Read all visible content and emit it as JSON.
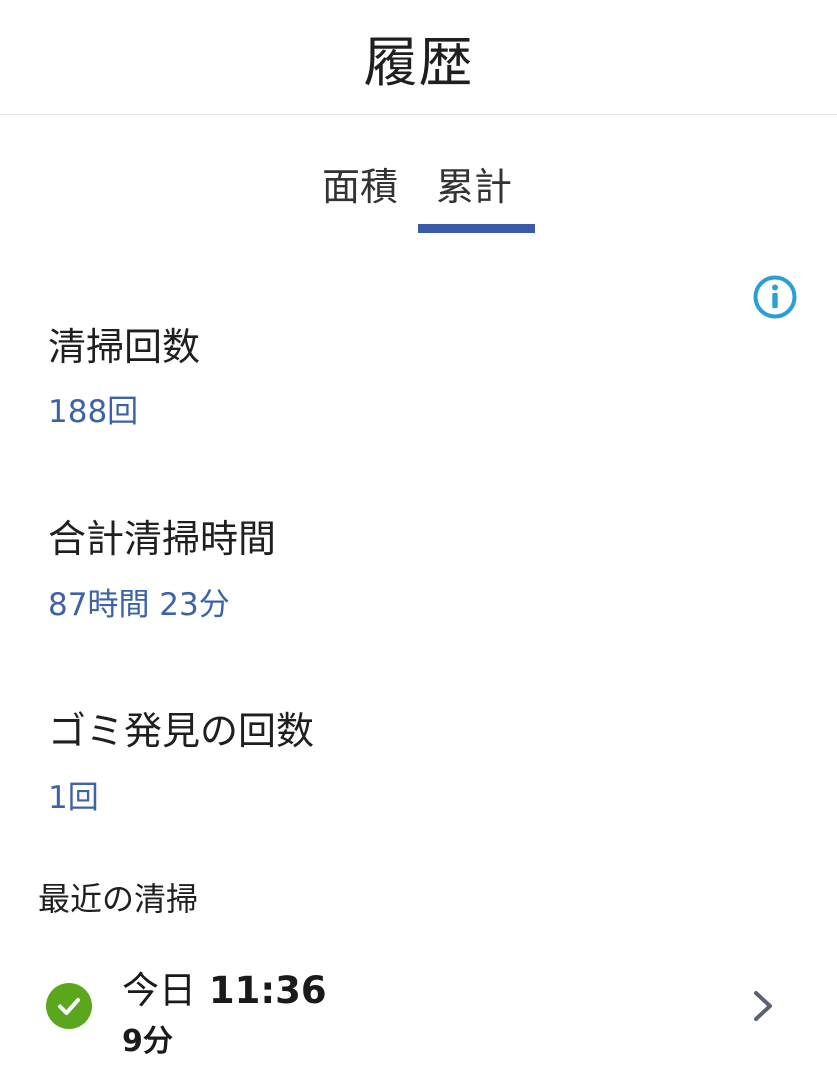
{
  "header": {
    "title": "履歴"
  },
  "tabs": [
    {
      "label": "面積",
      "selected": false
    },
    {
      "label": "累計",
      "selected": true
    }
  ],
  "accent_color": "#3a5ca8",
  "value_color": "#3d63a6",
  "info_icon": {
    "name": "info-icon",
    "color": "#2a9fd6"
  },
  "stats": {
    "cleaning_count": {
      "label": "清掃回数",
      "value": "188回"
    },
    "total_time": {
      "label": "合計清掃時間",
      "value": "87時間 23分"
    },
    "dirt_found": {
      "label": "ゴミ発見の回数",
      "value": "1回"
    }
  },
  "recent": {
    "heading": "最近の清掃",
    "items": [
      {
        "status_icon": "check-icon",
        "status_color": "#5aa61d",
        "day": "今日",
        "time": "11:36",
        "duration": "9分"
      }
    ]
  }
}
